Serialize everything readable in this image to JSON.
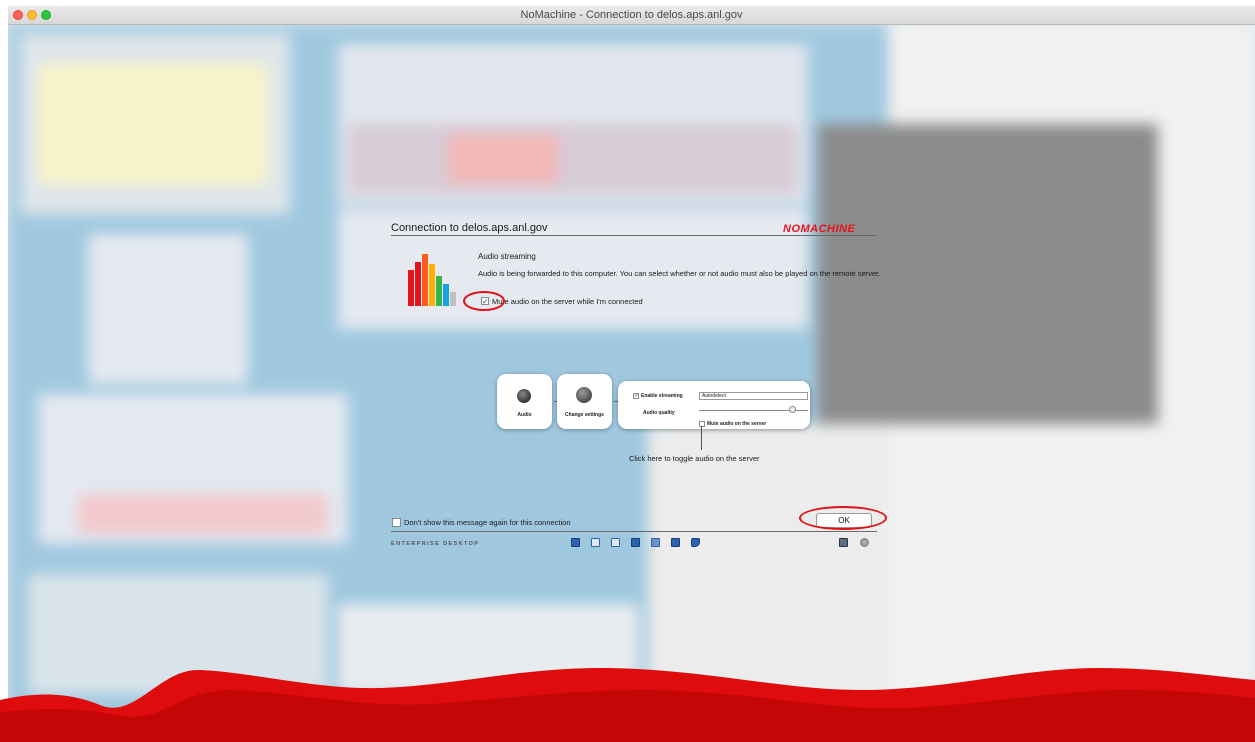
{
  "window": {
    "title": "NoMachine - Connection to delos.aps.anl.gov"
  },
  "dialog": {
    "title": "Connection to delos.aps.anl.gov",
    "brand": "NOMACHINE",
    "section_title": "Audio streaming",
    "description": "Audio is being forwarded to this computer. You can select whether or not audio must also be played on the remote server.",
    "mute_label": "Mute audio on the server while I'm connected",
    "mute_checked": true,
    "diagram": {
      "audio_label": "Audio",
      "change_settings_label": "Change settings",
      "enable_streaming_label": "Enable streaming",
      "audio_quality_label": "Audio quality",
      "quality_value": "Autodetect",
      "mute_small_label": "Mute audio on the server"
    },
    "caption": "Click here to toggle audio on the server",
    "dont_show_label": "Don't show this message again for this connection",
    "ok_label": "OK",
    "footer_text": "ENTERPRISE DESKTOP",
    "toolbar_icons": [
      "display-icon",
      "fit-icon",
      "resize-icon",
      "fullscreen-icon",
      "devices-icon",
      "display-settings-icon",
      "audio-icon"
    ],
    "right_icons": [
      "input-icon",
      "settings-icon"
    ]
  },
  "colors": {
    "brand_red": "#e4141b",
    "annotation_red": "#e01016",
    "bar_colors": [
      "#e4141b",
      "#ff5a1f",
      "#ffb000",
      "#37b44a",
      "#1aa1e0",
      "#c0c0c0"
    ]
  }
}
